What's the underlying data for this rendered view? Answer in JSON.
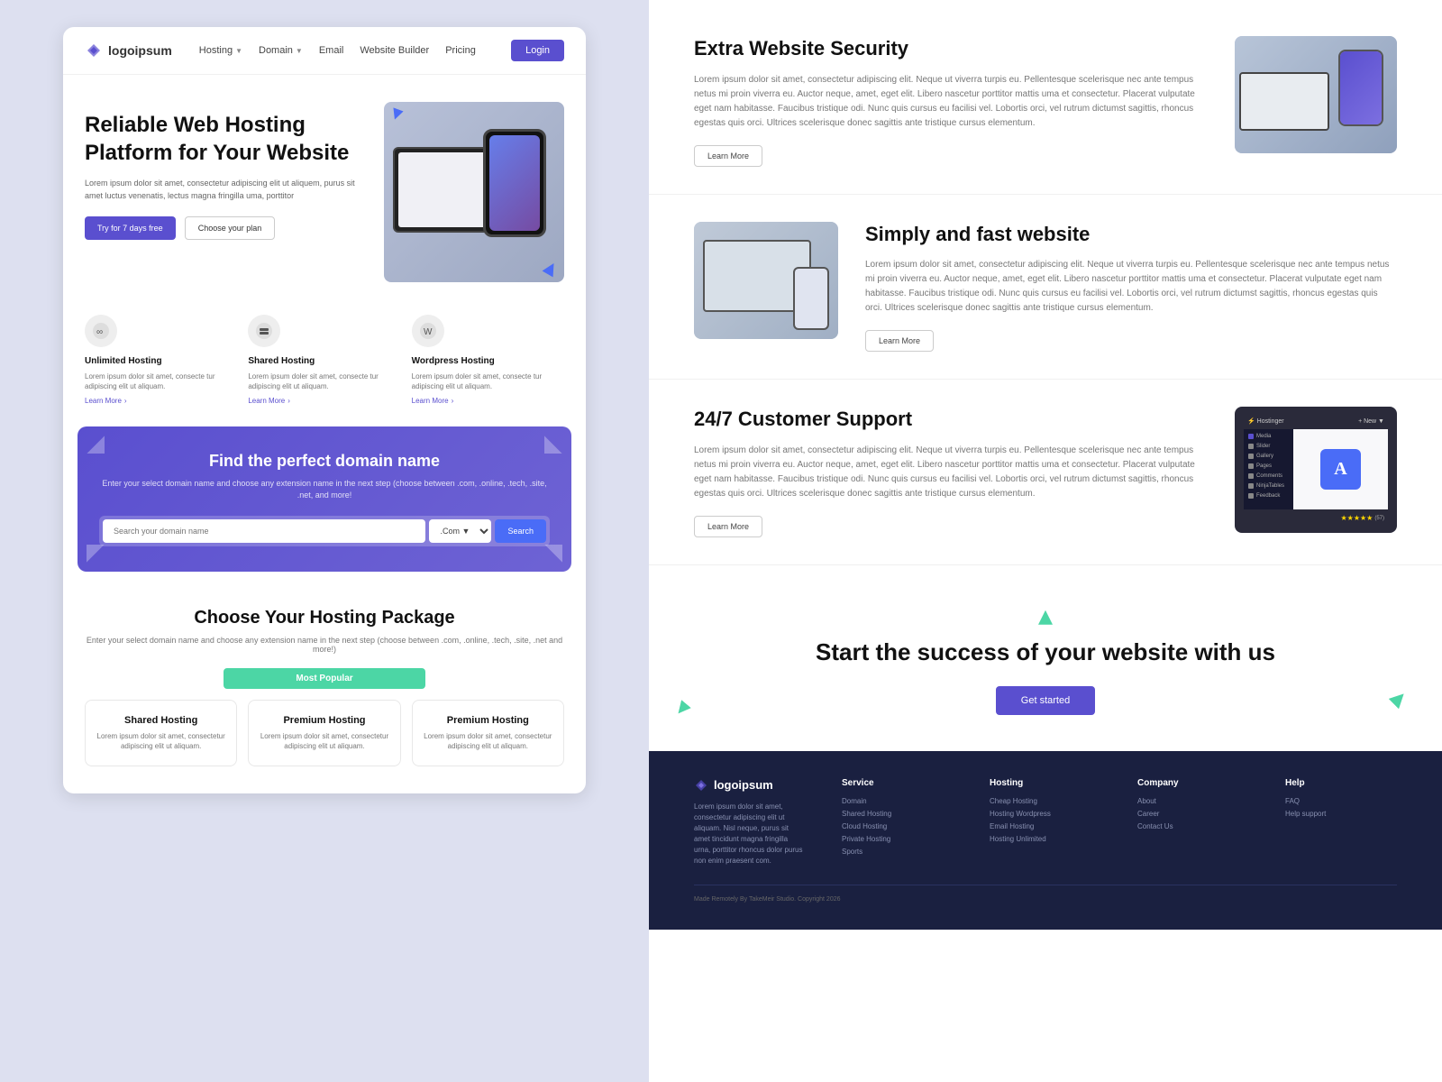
{
  "left": {
    "nav": {
      "logo": "logoipsum",
      "links": [
        "Hosting",
        "Domain",
        "Email",
        "Website Builder",
        "Pricing"
      ],
      "login": "Login"
    },
    "hero": {
      "title": "Reliable Web Hosting Platform for Your Website",
      "desc": "Lorem ipsum dolor sit amet, consectetur adipiscing elit ut aliquem, purus sit amet luctus venenatis, lectus magna fringilla uma, porttitor",
      "btn_trial": "Try for 7 days free",
      "btn_plan": "Choose your plan"
    },
    "features": [
      {
        "title": "Unlimited Hosting",
        "desc": "Lorem ipsum dolor sit amet, consecte tur adipiscing elit ut aliquam.",
        "learn": "Learn More"
      },
      {
        "title": "Shared Hosting",
        "desc": "Lorem ipsum doler sit amet, consecte tur adipiscing elit ut aliquam.",
        "learn": "Learn More"
      },
      {
        "title": "Wordpress Hosting",
        "desc": "Lorem ipsum doler sit amet, consecte tur adipiscing elit ut aliquam.",
        "learn": "Learn More"
      }
    ],
    "domain": {
      "title": "Find the perfect domain name",
      "desc": "Enter your select domain name and choose any extension name in the next step\n(choose between .com, .online, .tech, .site, .net, and more!",
      "placeholder": "Search your domain name",
      "extension_default": ".Com",
      "search_btn": "Search"
    },
    "packages": {
      "title": "Choose Your Hosting Package",
      "desc": "Enter your select domain name and choose any extension name in the next step\n(choose between .com, .online, .tech, .site, .net and more!)",
      "popular_label": "Most Popular",
      "cards": [
        {
          "name": "Shared Hosting",
          "desc": "Lorem ipsum dolor sit amet, consectetur adipiscing elit ut aliquam."
        },
        {
          "name": "Premium Hosting",
          "desc": "Lorem ipsum dolor sit amet, consectetur adipiscing elit ut aliquam."
        },
        {
          "name": "Premium Hosting",
          "desc": "Lorem ipsum dolor sit amet, consectetur adipiscing elit ut aliquam."
        }
      ]
    }
  },
  "right": {
    "security": {
      "title": "Extra Website Security",
      "desc": "Lorem ipsum dolor sit amet, consectetur adipiscing elit. Neque ut viverra turpis eu. Pellentesque scelerisque nec ante tempus netus mi proin viverra eu. Auctor neque, amet, eget elit. Libero nascetur porttitor mattis uma et consectetur. Placerat vulputate eget nam habitasse. Faucibus tristique odi. Nunc quis cursus eu facilisi vel. Lobortis orci, vel rutrum dictumst sagittis, rhoncus egestas quis orci. Ultrices scelerisque donec sagittis ante tristique cursus elementum.",
      "learn_more": "Learn More"
    },
    "simply_fast": {
      "title": "Simply and fast website",
      "desc": "Lorem ipsum dolor sit amet, consectetur adipiscing elit. Neque ut viverra turpis eu. Pellentesque scelerisque nec ante tempus netus mi proin viverra eu. Auctor neque, amet, eget elit. Libero nascetur porttitor mattis uma et consectetur. Placerat vulputate eget nam habitasse. Faucibus tristique odi. Nunc quis cursus eu facilisi vel. Lobortis orci, vel rutrum dictumst sagittis, rhoncus egestas quis orci. Ultrices scelerisque donec sagittis ante tristique cursus elementum.",
      "learn_more": "Learn More"
    },
    "support": {
      "title": "24/7 Customer Support",
      "desc": "Lorem ipsum dolor sit amet, consectetur adipiscing elit. Neque ut viverra turpis eu. Pellentesque scelerisque nec ante tempus netus mi proin viverra eu. Auctor neque, amet, eget elit. Libero nascetur porttitor mattis uma et consectetur. Placerat vulputate eget nam habitasse. Faucibus tristique odi. Nunc quis cursus eu facilisi vel. Lobortis orci, vel rutrum dictumst sagittis, rhoncus egestas quis orci. Ultrices scelerisque donec sagittis ante tristique cursus elementum.",
      "learn_more": "Learn More",
      "dashboard_items": [
        "Media",
        "Slider",
        "Gallery",
        "Pages",
        "Comments",
        "NinjaTables",
        "Feedback"
      ]
    },
    "success": {
      "title": "Start the success of your website with us",
      "cta": "Get started"
    },
    "footer": {
      "logo": "logoipsum",
      "desc": "Lorem ipsum dolor sit amet, consectetur adipiscing elit ut aliquam. Nisl neque, purus sit amet tincidunt magna fringilla urna, porttitor rhoncus dolor purus non enim praesent com.",
      "columns": [
        {
          "title": "Service",
          "links": [
            "Domain",
            "Shared Hosting",
            "Cloud Hosting",
            "Private Hosting",
            "Sports"
          ]
        },
        {
          "title": "Hosting",
          "links": [
            "Cheap Hosting",
            "Hosting Wordpress",
            "Email Hosting",
            "Hosting Unlimited"
          ]
        },
        {
          "title": "Company",
          "links": [
            "About",
            "Career",
            "Contact Us"
          ]
        },
        {
          "title": "Help",
          "links": [
            "FAQ",
            "Help support"
          ]
        }
      ],
      "copyright": "Made Remotely By TakeMeir Studio. Copyright 2026"
    }
  }
}
